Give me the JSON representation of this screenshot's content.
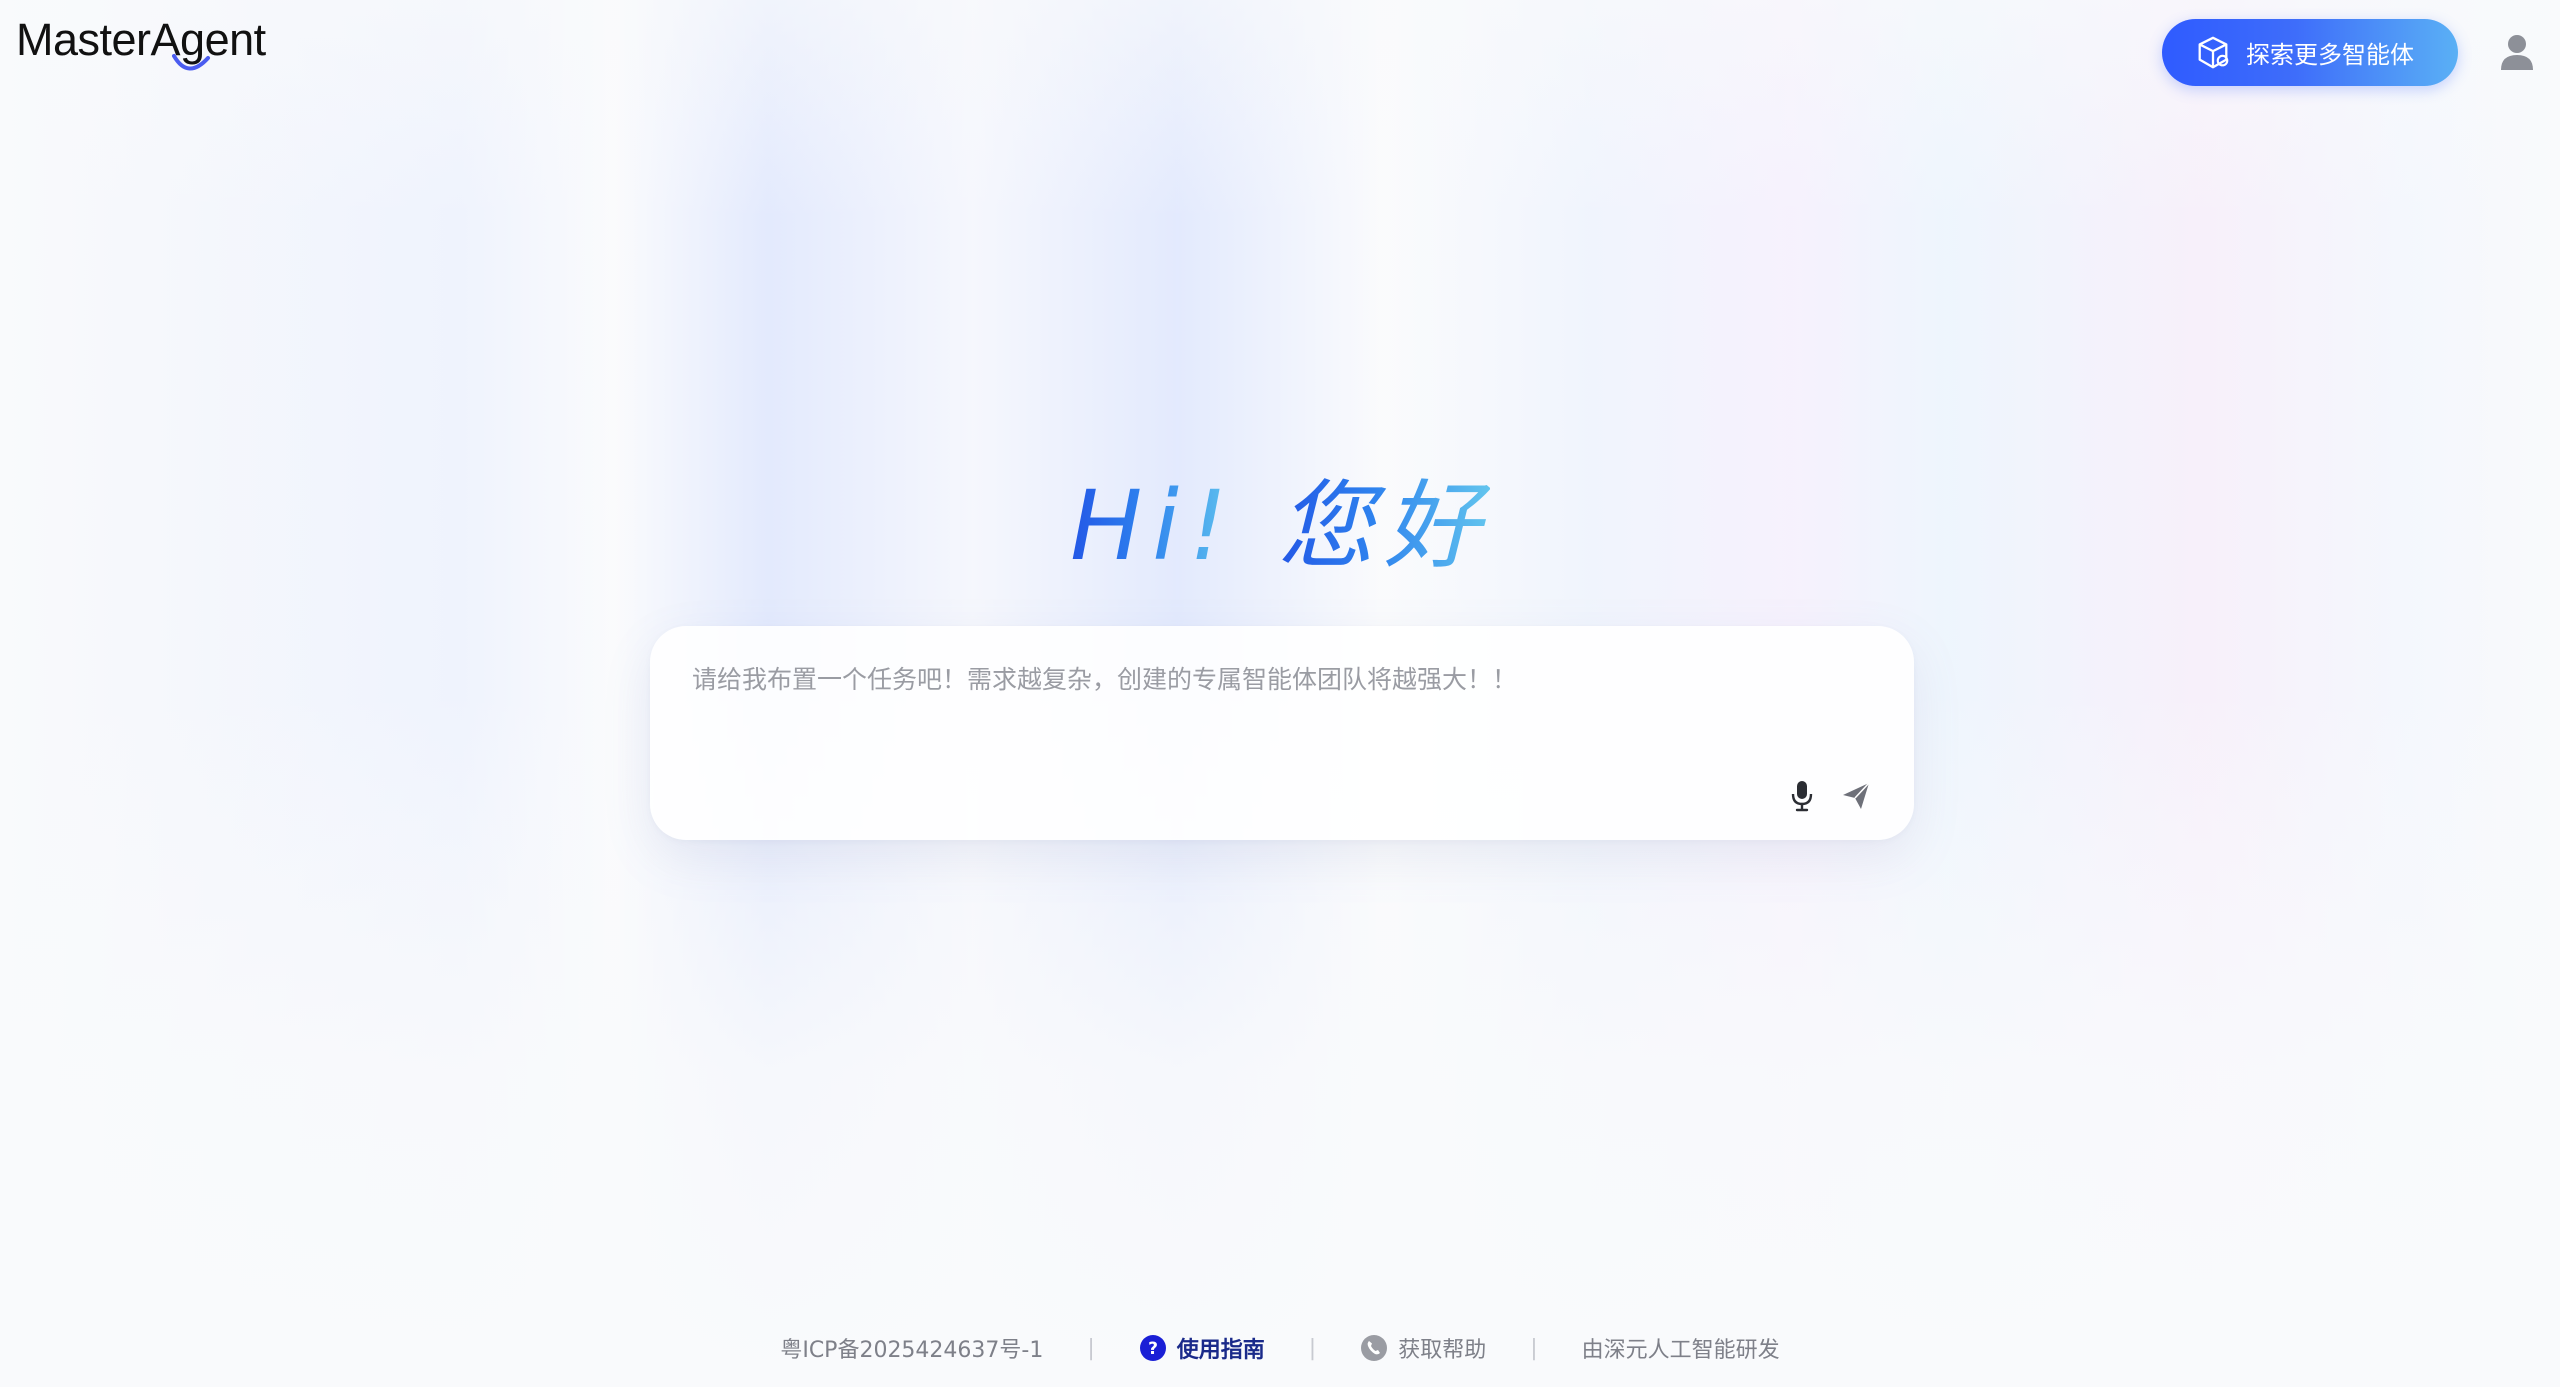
{
  "app": {
    "logo_text": "MasterAgent"
  },
  "header": {
    "explore_label": "探索更多智能体"
  },
  "hero": {
    "greeting_hi": "Hi!",
    "greeting_cn": "您好"
  },
  "composer": {
    "placeholder": "请给我布置一个任务吧！需求越复杂，创建的专属智能体团队将越强大！！",
    "value": ""
  },
  "footer": {
    "icp": "粤ICP备2025424637号-1",
    "guide_label": "使用指南",
    "help_label": "获取帮助",
    "credit": "由深元人工智能研发",
    "separator": "|"
  },
  "colors": {
    "accent": "#2f5bff",
    "accent_end": "#5ab0f5",
    "guide_icon": "#1a1fd6",
    "muted_text": "#7e8089"
  },
  "icons": {
    "explore": "cube-icon",
    "user": "user-icon",
    "mic": "microphone-icon",
    "send": "send-icon",
    "guide": "question-circle-icon",
    "help": "phone-icon"
  }
}
